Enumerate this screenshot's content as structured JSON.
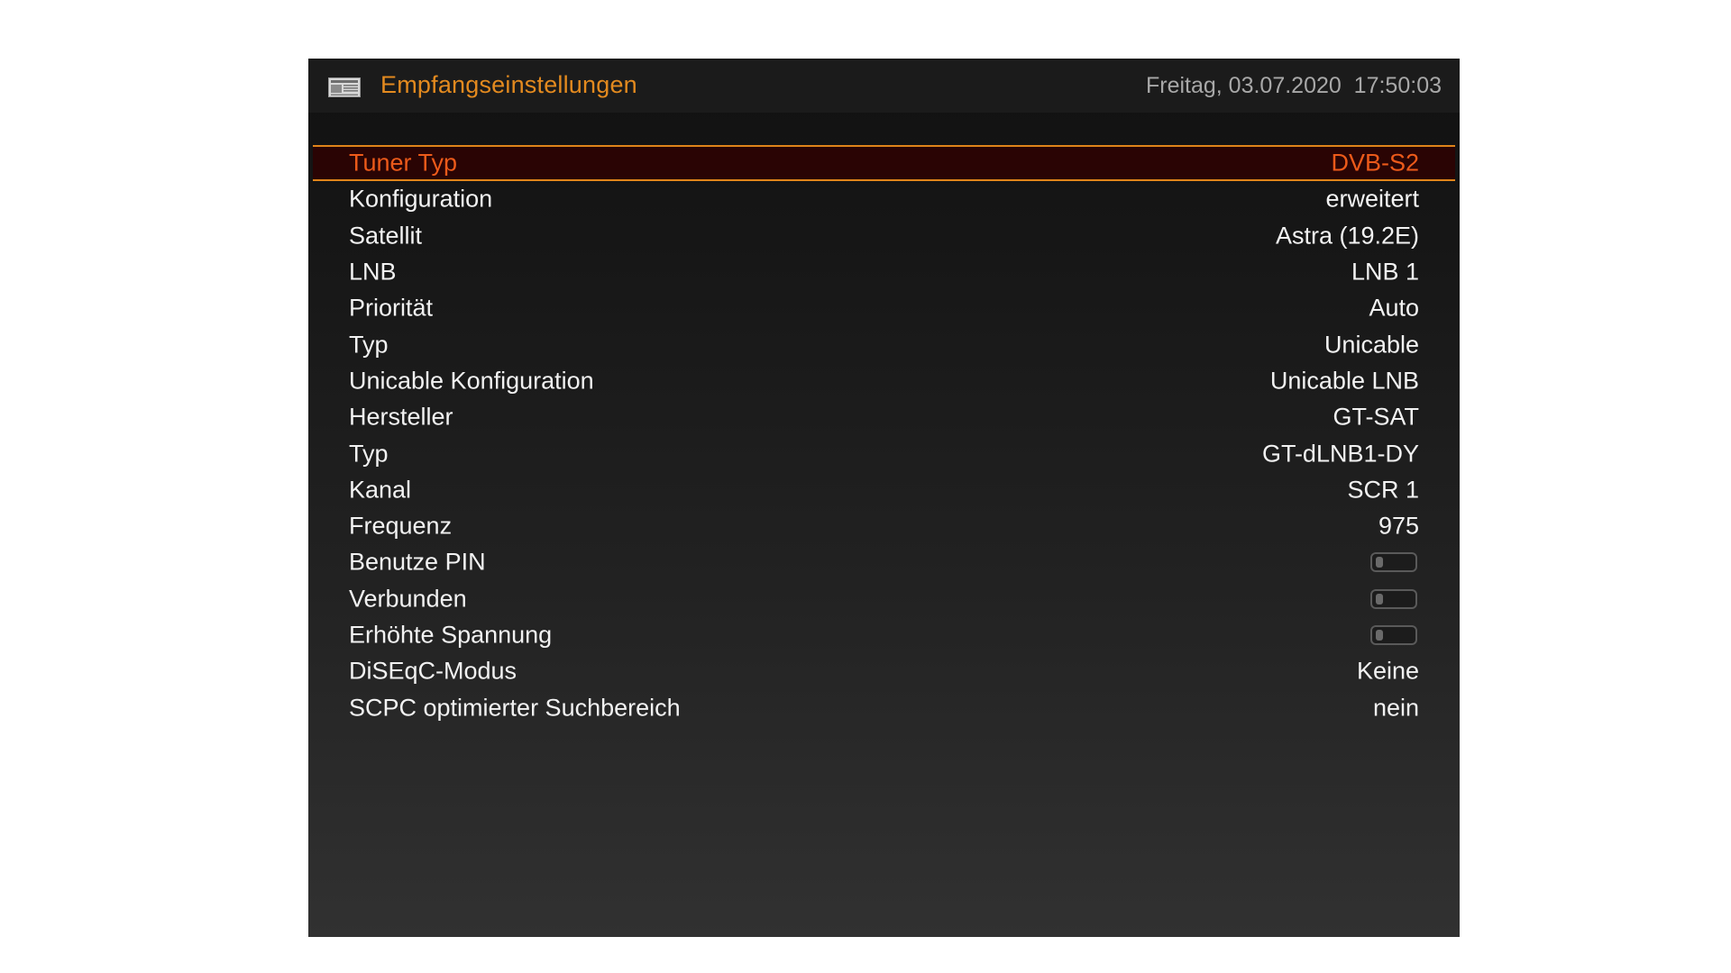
{
  "header": {
    "icon": "newspaper-icon",
    "title": "Empfangseinstellungen",
    "datetime": "Freitag, 03.07.2020  17:50:03"
  },
  "colors": {
    "title": "#e38a1f",
    "selected_text": "#ec5a1a",
    "selected_border": "#e0841a",
    "selected_background": "#2a0404",
    "text": "#f2f2f2",
    "datetime": "#a8a8a8"
  },
  "menu": {
    "selected_index": 0,
    "items": [
      {
        "label": "Tuner Typ",
        "value": "DVB-S2"
      },
      {
        "label": "Konfiguration",
        "value": "erweitert"
      },
      {
        "label": "Satellit",
        "value": "Astra (19.2E)"
      },
      {
        "label": "LNB",
        "value": "LNB 1"
      },
      {
        "label": "Priorität",
        "value": "Auto"
      },
      {
        "label": "Typ",
        "value": "Unicable"
      },
      {
        "label": "Unicable Konfiguration",
        "value": "Unicable LNB"
      },
      {
        "label": "Hersteller",
        "value": "GT-SAT"
      },
      {
        "label": "Typ",
        "value": "GT-dLNB1-DY"
      },
      {
        "label": "Kanal",
        "value": "SCR 1"
      },
      {
        "label": "Frequenz",
        "value": "975"
      },
      {
        "label": "Benutze PIN",
        "toggle": false
      },
      {
        "label": "Verbunden",
        "toggle": false
      },
      {
        "label": "Erhöhte Spannung",
        "toggle": false
      },
      {
        "label": "DiSEqC-Modus",
        "value": "Keine"
      },
      {
        "label": "SCPC optimierter Suchbereich",
        "value": "nein"
      }
    ]
  }
}
